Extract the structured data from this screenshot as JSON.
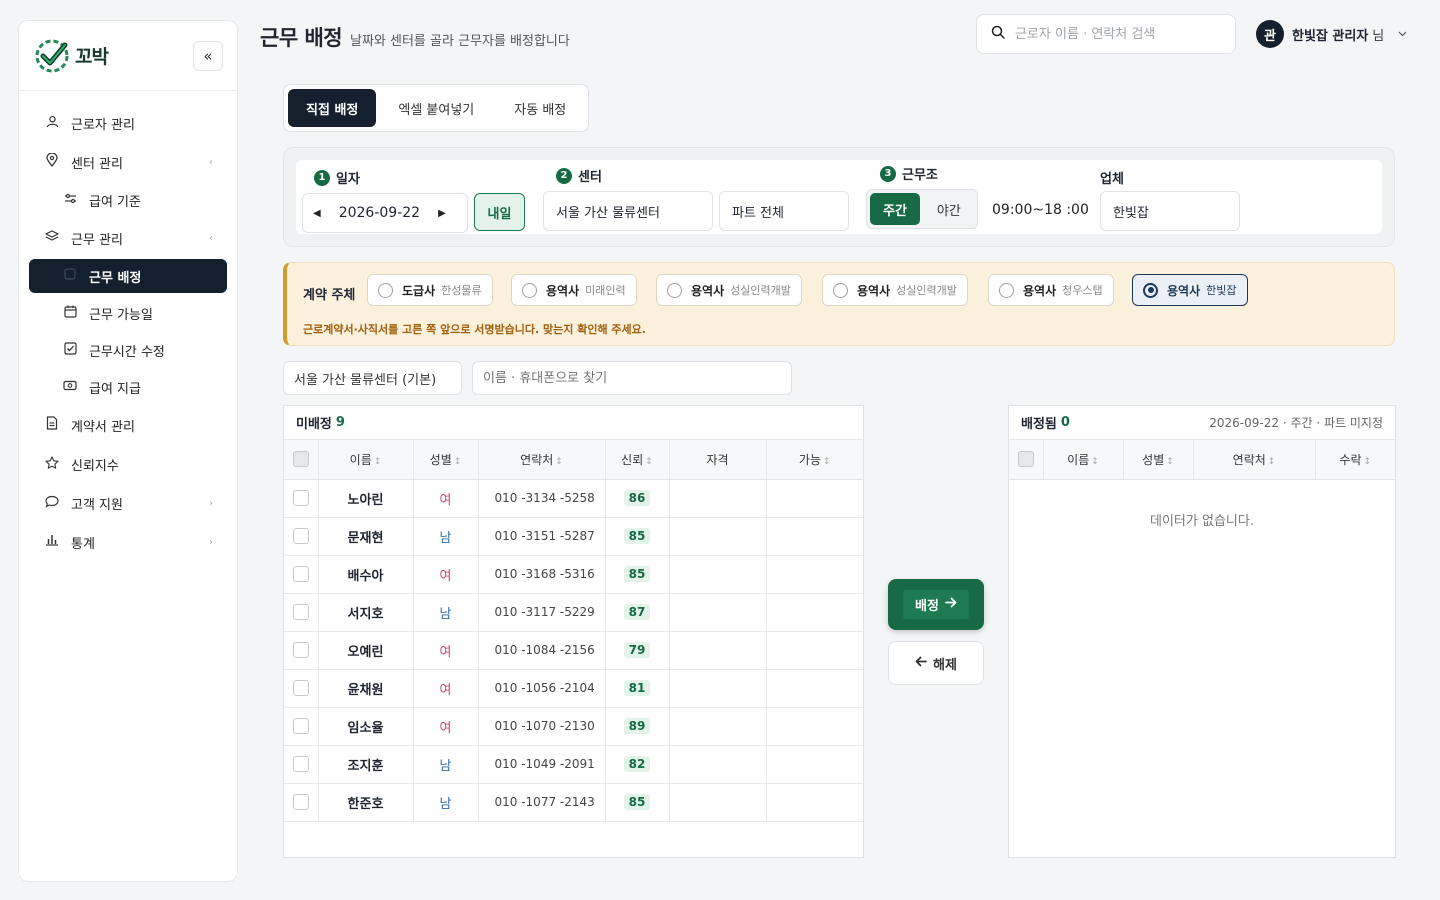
{
  "brand": {
    "name": "꼬박"
  },
  "sidebar": {
    "collapse_icon": "«",
    "items": [
      {
        "label": "근로자 관리",
        "icon": "user-icon",
        "chevron": ""
      },
      {
        "label": "센터 관리",
        "icon": "location-pin-icon",
        "chevron": "‹"
      },
      {
        "label": "급여 기준",
        "icon": "sliders-icon",
        "chevron": ""
      },
      {
        "label": "근무 관리",
        "icon": "layers-icon",
        "chevron": "‹"
      },
      {
        "label": "근무 배정",
        "icon": "assign-icon",
        "chevron": ""
      },
      {
        "label": "근무 가능일",
        "icon": "calendar-icon",
        "chevron": ""
      },
      {
        "label": "근무시간 수정",
        "icon": "checkbox-icon",
        "chevron": ""
      },
      {
        "label": "급여 지급",
        "icon": "money-icon",
        "chevron": ""
      },
      {
        "label": "계약서 관리",
        "icon": "document-icon",
        "chevron": ""
      },
      {
        "label": "신뢰지수",
        "icon": "star-icon",
        "chevron": ""
      },
      {
        "label": "고객 지원",
        "icon": "chat-icon",
        "chevron": "›"
      },
      {
        "label": "통계",
        "icon": "bar-chart-icon",
        "chevron": "›"
      }
    ]
  },
  "header": {
    "title": "근무 배정",
    "subtitle": "날짜와 센터를 골라 근무자를 배정합니다",
    "search_placeholder": "근로자 이름 · 연락처 검색",
    "user_initial": "관",
    "user_name": "한빛잡 관리자",
    "user_suffix": "님"
  },
  "tabs": [
    "직접 배정",
    "엑셀 붙여넣기",
    "자동 배정"
  ],
  "filters": {
    "date_step": "1",
    "date_label": "일자",
    "date_value": "2026-09-22",
    "tomorrow_label": "내일",
    "center_step": "2",
    "center_label": "센터",
    "center_value": "서울 가산 물류센터",
    "part_value": "파트 전체",
    "shift_step": "3",
    "shift_label": "근무조",
    "shift_day": "주간",
    "shift_night": "야간",
    "shift_time": "09:00~18 :00",
    "company_label": "업체",
    "company_value": "한빛잡"
  },
  "contract": {
    "label": "계약 주체",
    "options": [
      {
        "type": "도급사",
        "name": "한성물류"
      },
      {
        "type": "용역사",
        "name": "미래인력"
      },
      {
        "type": "용역사",
        "name": "성실인력개발"
      },
      {
        "type": "용역사",
        "name": "성실인력개발"
      },
      {
        "type": "용역사",
        "name": "청우스탭"
      },
      {
        "type": "용역사",
        "name": "한빛잡"
      }
    ],
    "note": "근로계약서·사직서를 고른 쪽 앞으로 서명받습니다. 맞는지 확인해 주세요."
  },
  "search_row": {
    "center_filter": "서울 가산 물류센터 (기본)",
    "name_search_placeholder": "이름 · 휴대폰으로 찾기"
  },
  "unassigned": {
    "title": "미배정",
    "count": "9",
    "columns": [
      "이름",
      "성별",
      "연락처",
      "신뢰",
      "자격",
      "가능"
    ],
    "sort_glyph": "↕",
    "rows": [
      {
        "name": "노아린",
        "gender": "여",
        "phone": "010 -3134 -5258",
        "trust": "86"
      },
      {
        "name": "문재현",
        "gender": "남",
        "phone": "010 -3151 -5287",
        "trust": "85"
      },
      {
        "name": "배수아",
        "gender": "여",
        "phone": "010 -3168 -5316",
        "trust": "85"
      },
      {
        "name": "서지호",
        "gender": "남",
        "phone": "010 -3117 -5229",
        "trust": "87"
      },
      {
        "name": "오예린",
        "gender": "여",
        "phone": "010 -1084 -2156",
        "trust": "79"
      },
      {
        "name": "윤채원",
        "gender": "여",
        "phone": "010 -1056 -2104",
        "trust": "81"
      },
      {
        "name": "임소율",
        "gender": "여",
        "phone": "010 -1070 -2130",
        "trust": "89"
      },
      {
        "name": "조지훈",
        "gender": "남",
        "phone": "010 -1049 -2091",
        "trust": "82"
      },
      {
        "name": "한준호",
        "gender": "남",
        "phone": "010 -1077 -2143",
        "trust": "85"
      }
    ]
  },
  "assigned": {
    "title": "배정됨",
    "count": "0",
    "meta": "2026-09-22 · 주간 · 파트 미지정",
    "columns": [
      "이름",
      "성별",
      "연락처",
      "수락"
    ],
    "empty": "데이터가 없습니다."
  },
  "actions": {
    "assign": "배정",
    "release": "해제"
  },
  "colors": {
    "accent": "#166b45",
    "dark": "#14202d",
    "female": "#c94963",
    "male": "#2f6aa8",
    "warning_bg": "#fbf1dd"
  }
}
